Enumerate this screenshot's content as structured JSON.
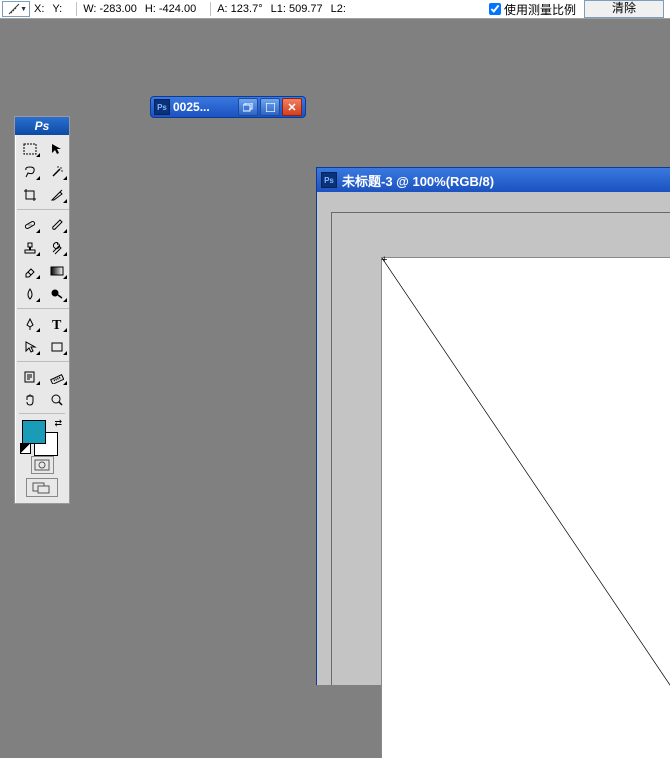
{
  "info_bar": {
    "x_label": "X:",
    "y_label": "Y:",
    "w_label": "W:",
    "w_value": "-283.00",
    "h_label": "H:",
    "h_value": "-424.00",
    "a_label": "A:",
    "a_value": "123.7°",
    "l1_label": "L1:",
    "l1_value": "509.77",
    "l2_label": "L2:",
    "use_scale_label": "使用测量比例",
    "clear_btn": "清除"
  },
  "palette": {
    "title": "Ps"
  },
  "mini_window": {
    "title": "0025..."
  },
  "doc_window": {
    "title": "未标题-3 @ 100%(RGB/8)"
  }
}
